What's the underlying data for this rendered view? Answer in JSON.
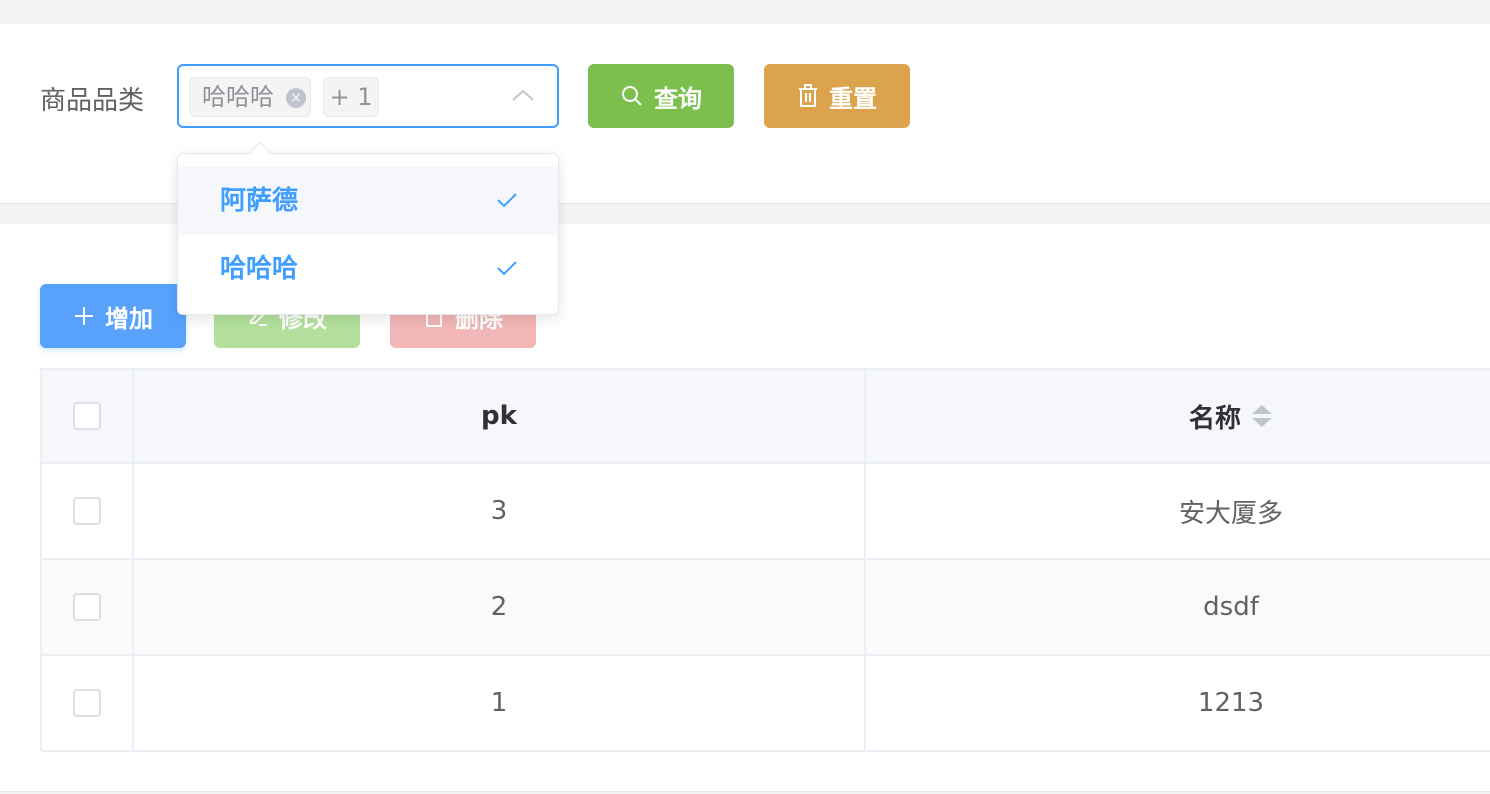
{
  "search": {
    "label": "商品品类",
    "tags": [
      "哈哈哈",
      "+ 1"
    ],
    "query_label": "查询",
    "reset_label": "重置"
  },
  "dropdown": {
    "options": [
      {
        "label": "阿萨德",
        "selected": true
      },
      {
        "label": "哈哈哈",
        "selected": true
      }
    ]
  },
  "toolbar": {
    "add_label": "增加",
    "edit_label": "修改",
    "delete_label": "删除"
  },
  "table": {
    "columns": [
      "pk",
      "名称"
    ],
    "rows": [
      {
        "pk": "3",
        "name": "安大厦多"
      },
      {
        "pk": "2",
        "name": "dsdf"
      },
      {
        "pk": "1",
        "name": "1213"
      }
    ]
  },
  "colors": {
    "primary": "#409eff",
    "success": "#7dbf4f",
    "warning": "#dba44c",
    "danger_disabled": "#f3b6b6"
  }
}
